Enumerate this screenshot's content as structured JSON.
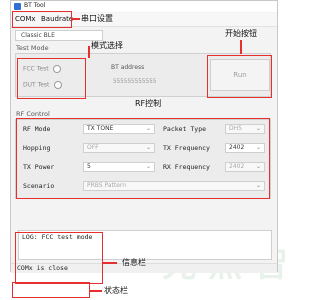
{
  "window": {
    "title": "BT Tool"
  },
  "menu": {
    "comx": "COMx",
    "baudrate": "Baudrate"
  },
  "tab": {
    "label": "Classic BLE"
  },
  "test_mode": {
    "label": "Test Mode",
    "options": [
      "FCC Test",
      "DUT Test"
    ]
  },
  "bt_address": {
    "label": "BT address",
    "value": "555555555555"
  },
  "run_button": "Run",
  "rf_control": {
    "label": "RF Control",
    "rf_mode": {
      "label": "RF Mode",
      "value": "TX TONE"
    },
    "hopping": {
      "label": "Hopping",
      "value": "OFF"
    },
    "tx_power": {
      "label": "TX Power",
      "value": "5"
    },
    "scenario": {
      "label": "Scenario",
      "value": "PRBS Pattern"
    },
    "packet_type": {
      "label": "Packet Type",
      "value": "DH5"
    },
    "tx_frequency": {
      "label": "TX Frequency",
      "value": "2402"
    },
    "rx_frequency": {
      "label": "RX Frequency",
      "value": "2402"
    }
  },
  "log": {
    "text": "LOG: FCC test mode"
  },
  "status": {
    "text": "COMx is close"
  },
  "annotations": {
    "serial_settings": "串口设置",
    "mode_select": "模式选择",
    "start_button": "开始按钮",
    "rf_control": "RF控制",
    "info_bar": "信息栏",
    "status_bar": "状态栏"
  },
  "watermark": "光 照 智"
}
